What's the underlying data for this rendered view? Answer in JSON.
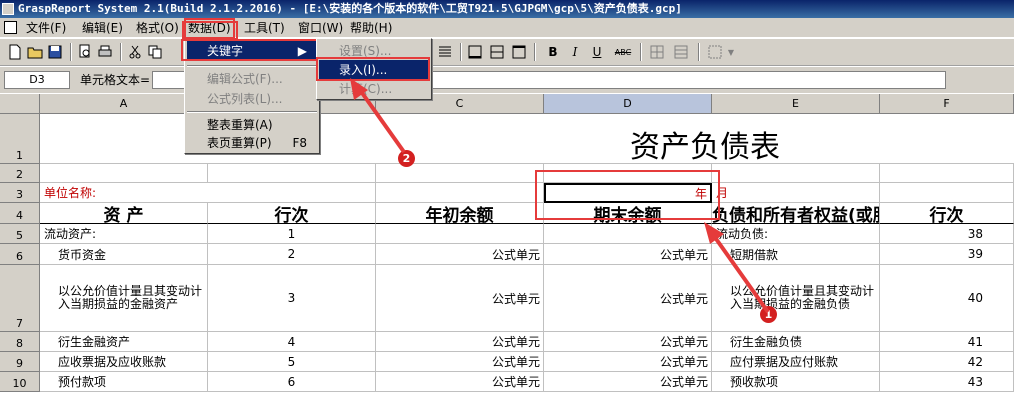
{
  "window": {
    "title": "GraspReport System 2.1(Build 2.1.2.2016) - [E:\\安装的各个版本的软件\\工贸T921.5\\GJPGM\\gcp\\5\\资产负债表.gcp]"
  },
  "menubar": {
    "items": [
      "文件(F)",
      "编辑(E)",
      "格式(O)",
      "数据(D)",
      "工具(T)",
      "窗口(W)",
      "帮助(H)"
    ]
  },
  "data_menu": {
    "items": [
      {
        "label": "关键字",
        "shortcut": "",
        "state": "highlighted",
        "submenu": true
      },
      {
        "label": "编辑公式(F)...",
        "shortcut": "",
        "state": "disabled"
      },
      {
        "label": "公式列表(L)...",
        "shortcut": "",
        "state": "disabled"
      },
      {
        "label": "整表重算(A)",
        "shortcut": "",
        "state": "normal"
      },
      {
        "label": "表页重算(P)",
        "shortcut": "F8",
        "state": "normal"
      }
    ]
  },
  "keyword_submenu": {
    "items": [
      {
        "label": "设置(S)...",
        "state": "disabled"
      },
      {
        "label": "录入(I)...",
        "state": "highlighted"
      },
      {
        "label": "计算(C)...",
        "state": "disabled"
      }
    ]
  },
  "toolbar": {
    "bold": "B",
    "italic": "I",
    "underline": "U",
    "strike": "ABC"
  },
  "formula_bar": {
    "cell_ref": "D3",
    "label": "单元格文本=",
    "value": ""
  },
  "grid": {
    "columns": [
      "A",
      "B",
      "C",
      "D",
      "E",
      "F"
    ],
    "selected_column": "D",
    "rows": [
      "1",
      "2",
      "3",
      "4",
      "5",
      "6",
      "7",
      "8",
      "9",
      "10"
    ],
    "title": "资产负债表",
    "unit_label": "单位名称:",
    "year_text": "年",
    "month_text": "月",
    "header": [
      "资 产",
      "行次",
      "年初余额",
      "期末余额",
      "负债和所有者权益(或股东权益)",
      "行次"
    ],
    "data_rows": [
      {
        "a": "流动资产:",
        "b": "1",
        "c": "",
        "d": "",
        "e": "流动负债:",
        "f": "38"
      },
      {
        "a": "货币资金",
        "b": "2",
        "c": "公式单元",
        "d": "公式单元",
        "e": "短期借款",
        "f": "39"
      },
      {
        "a": "以公允价值计量且其变动计入当期损益的金融资产",
        "b": "3",
        "c": "公式单元",
        "d": "公式单元",
        "e": "以公允价值计量且其变动计入当期损益的金融负债",
        "f": "40"
      },
      {
        "a": "衍生金融资产",
        "b": "4",
        "c": "公式单元",
        "d": "公式单元",
        "e": "衍生金融负债",
        "f": "41"
      },
      {
        "a": "应收票据及应收账款",
        "b": "5",
        "c": "公式单元",
        "d": "公式单元",
        "e": "应付票据及应付账款",
        "f": "42"
      },
      {
        "a": "预付款项",
        "b": "6",
        "c": "公式单元",
        "d": "公式单元",
        "e": "预收款项",
        "f": "43"
      }
    ]
  },
  "annotations": {
    "badge1": "1",
    "badge2": "2",
    "color": "#e53b3b"
  }
}
